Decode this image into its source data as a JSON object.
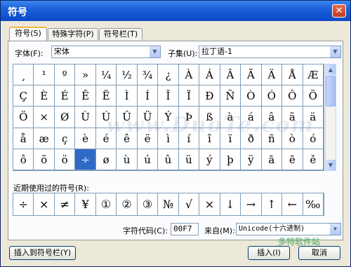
{
  "window": {
    "title": "符号",
    "close_glyph": "✕"
  },
  "tabs": [
    {
      "label": "符号(S)"
    },
    {
      "label": "特殊字符(P)"
    },
    {
      "label": "符号栏(T)"
    }
  ],
  "font": {
    "label": "字体(F):",
    "value": "宋体"
  },
  "subset": {
    "label": "子集(U):",
    "value": "拉丁语-1"
  },
  "symbols": [
    [
      "¸",
      "¹",
      "º",
      "»",
      "¼",
      "½",
      "¾",
      "¿",
      "À",
      "Á",
      "Â",
      "Ã",
      "Ä",
      "Å",
      "Æ"
    ],
    [
      "Ç",
      "È",
      "É",
      "Ê",
      "Ë",
      "Ì",
      "Í",
      "Î",
      "Ï",
      "Ð",
      "Ñ",
      "Ò",
      "Ó",
      "Ô",
      "Õ"
    ],
    [
      "Ö",
      "×",
      "Ø",
      "Ù",
      "Ú",
      "Û",
      "Ü",
      "Ý",
      "Þ",
      "ß",
      "à",
      "á",
      "â",
      "ã",
      "ä"
    ],
    [
      "å",
      "æ",
      "ç",
      "è",
      "é",
      "ê",
      "ë",
      "ì",
      "í",
      "î",
      "ï",
      "ð",
      "ñ",
      "ò",
      "ó"
    ],
    [
      "ô",
      "õ",
      "ö",
      "÷",
      "ø",
      "ù",
      "ú",
      "û",
      "ü",
      "ý",
      "þ",
      "ÿ",
      "ā",
      "ē",
      "ě"
    ]
  ],
  "selected_symbol": "÷",
  "recent": {
    "label": "近期使用过的符号(R):",
    "symbols": [
      "÷",
      "×",
      "≠",
      "¥",
      "①",
      "②",
      "③",
      "№",
      "√",
      "×",
      "↓",
      "→",
      "↑",
      "←",
      "‰"
    ]
  },
  "char_code": {
    "label": "字符代码(C):",
    "value": "00F7"
  },
  "from": {
    "label": "来自(M):",
    "value": "Unicode(十六进制)"
  },
  "buttons": {
    "insert_to_bar": "插入到符号栏(Y)",
    "insert": "插入(I)",
    "cancel": "取消"
  },
  "scroll_arrows": {
    "up": "▲",
    "down": "▼"
  },
  "combo_arrow": "▼",
  "watermark": {
    "main": "www.DuoTe.com",
    "corner": "多特软件站"
  },
  "colors": {
    "selection": "#316ac5",
    "titlebar": "#0a49c9"
  }
}
